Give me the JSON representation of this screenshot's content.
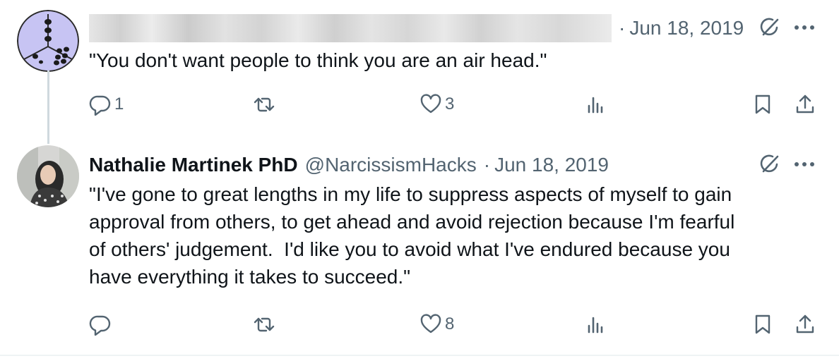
{
  "tweets": [
    {
      "name": "",
      "handle": "",
      "separator": "·",
      "date": "Jun 18, 2019",
      "text": "\"You don't want people to think you are an air head.\"",
      "avatar_icon": "dice-avatar",
      "counts": {
        "replies": "1",
        "retweets": "",
        "likes": "3"
      }
    },
    {
      "name": "Nathalie Martinek PhD",
      "handle": "@NarcissismHacks",
      "separator": "·",
      "date": "Jun 18, 2019",
      "text": "\"I've gone to great lengths in my life to suppress aspects of myself to gain\napproval from others, to get ahead and avoid rejection because I'm fearful\nof others' judgement.  I'd like you to avoid what I've endured because you\nhave everything it takes to succeed.\"",
      "avatar_icon": "profile-photo",
      "counts": {
        "replies": "",
        "retweets": "",
        "likes": "8"
      }
    }
  ],
  "icons": [
    "reply-icon",
    "retweet-icon",
    "like-icon",
    "views-icon",
    "bookmark-icon",
    "share-icon",
    "grok-icon",
    "more-icon"
  ],
  "colors": {
    "text": "#0f1419",
    "secondary": "#536471",
    "thread_line": "#cfd9de",
    "avatar_dice": "#c7c4f3"
  }
}
